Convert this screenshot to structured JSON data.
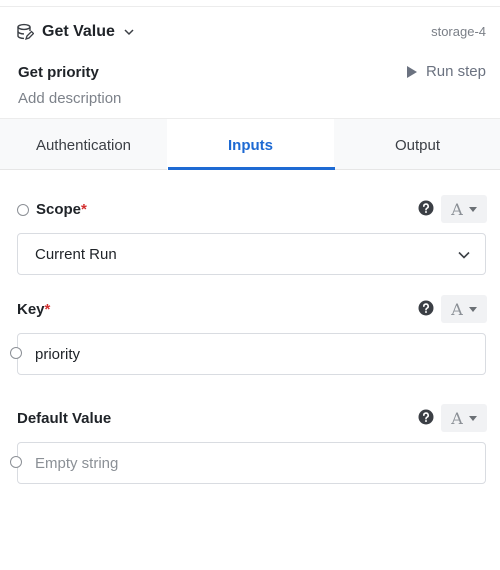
{
  "header": {
    "action_title": "Get Value",
    "step_id": "storage-4",
    "icons": {
      "piece": "database-icon",
      "dropdown": "chevron-down-icon"
    }
  },
  "step": {
    "name": "Get priority",
    "description_placeholder": "Add description",
    "run_label": "Run step"
  },
  "tabs": [
    {
      "label": "Authentication",
      "active": false
    },
    {
      "label": "Inputs",
      "active": true
    },
    {
      "label": "Output",
      "active": false
    }
  ],
  "fields": {
    "scope": {
      "label": "Scope",
      "required_mark": "*",
      "value": "Current Run",
      "type_glyph": "A"
    },
    "key": {
      "label": "Key",
      "required_mark": "*",
      "value": "priority",
      "type_glyph": "A"
    },
    "default_value": {
      "label": "Default Value",
      "placeholder": "Empty string",
      "type_glyph": "A"
    }
  },
  "colors": {
    "accent": "#1e6ad3",
    "required": "#d32f2f"
  }
}
